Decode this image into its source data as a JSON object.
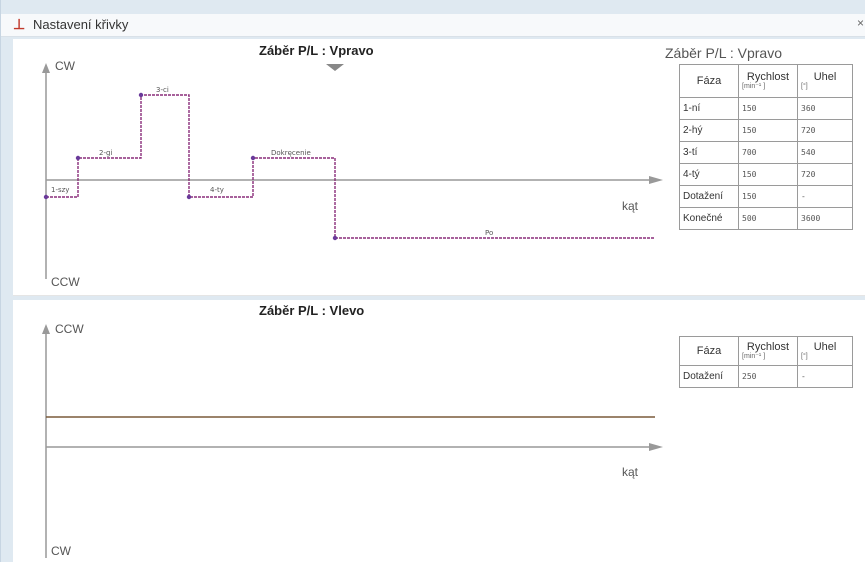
{
  "window": {
    "title": "Nastavení křivky",
    "close": "×"
  },
  "top": {
    "title": "Záběr  P/L : Vpravo",
    "table_title": "Záběr  P/L : Vpravo",
    "axis_top": "CW",
    "axis_bottom": "CCW",
    "axis_right": "kąt",
    "steps": {
      "s1": "1-szy",
      "s2": "2-gi",
      "s3": "3-ci",
      "s4": "4-ty",
      "dokr": "Dokręcenie",
      "po": "Po"
    },
    "headers": {
      "phase": "Fáza",
      "speed": "Rychlost",
      "speed_unit": "[min⁻¹ ]",
      "angle": "Uhel",
      "angle_unit": "[°]"
    },
    "rows": [
      {
        "phase": "1-ní",
        "speed": "150",
        "angle": "360"
      },
      {
        "phase": "2-hý",
        "speed": "150",
        "angle": "720"
      },
      {
        "phase": "3-tí",
        "speed": "700",
        "angle": "540"
      },
      {
        "phase": "4-tý",
        "speed": "150",
        "angle": "720"
      },
      {
        "phase": "Dotažení",
        "speed": "150",
        "angle": "-"
      },
      {
        "phase": "Konečné",
        "speed": "500",
        "angle": "3600"
      }
    ]
  },
  "bottom": {
    "title": "Záběr  P/L : Vlevo",
    "axis_top": "CCW",
    "axis_bottom": "CW",
    "axis_right": "kąt",
    "headers": {
      "phase": "Fáza",
      "speed": "Rychlost",
      "speed_unit": "[min⁻¹ ]",
      "angle": "Uhel",
      "angle_unit": "[°]"
    },
    "rows": [
      {
        "phase": "Dotažení",
        "speed": "250",
        "angle": "-"
      }
    ]
  },
  "colors": {
    "curve": "#8a2d7a",
    "curve_flat": "#7a5a3a",
    "axis": "#999999"
  }
}
